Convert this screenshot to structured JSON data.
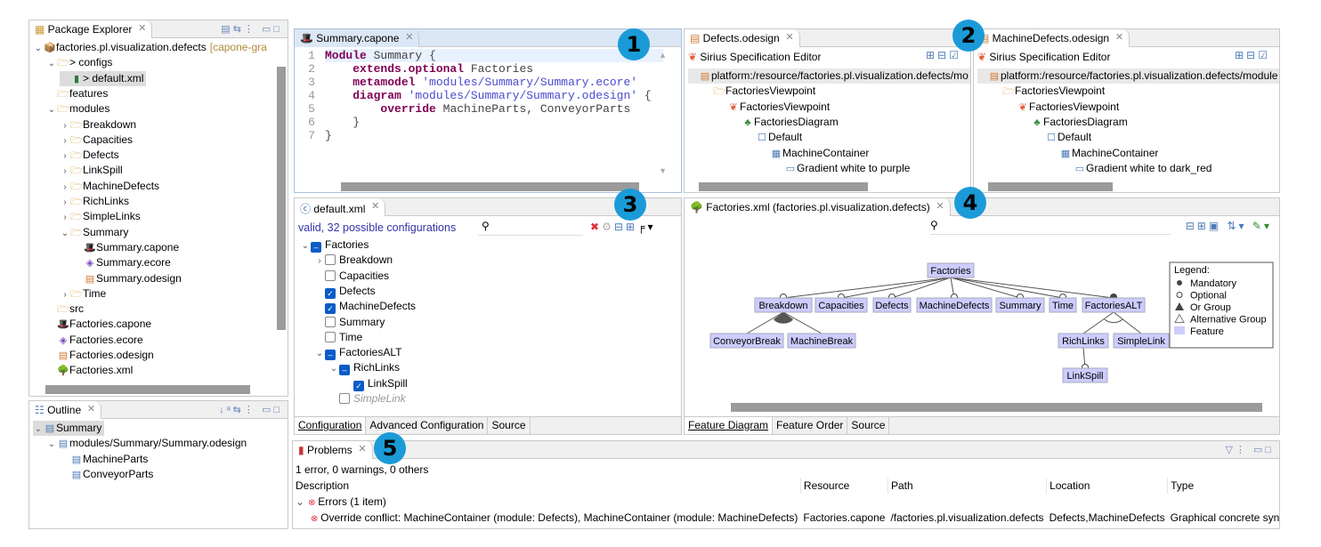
{
  "package_explorer": {
    "title": "Package Explorer",
    "items": [
      {
        "label": "factories.pl.visualization.defects",
        "suffix": "[capone-gra",
        "depth": 0,
        "tw": "v",
        "icon": "project-icon"
      },
      {
        "label": "> configs",
        "depth": 1,
        "tw": "v",
        "icon": "folder-icon"
      },
      {
        "label": "> default.xml",
        "depth": 2,
        "tw": "",
        "icon": "config-file-icon",
        "selected": true
      },
      {
        "label": "features",
        "depth": 1,
        "tw": "",
        "icon": "folder-icon"
      },
      {
        "label": "modules",
        "depth": 1,
        "tw": "v",
        "icon": "folder-icon"
      },
      {
        "label": "Breakdown",
        "depth": 2,
        "tw": ">",
        "icon": "folder-icon"
      },
      {
        "label": "Capacities",
        "depth": 2,
        "tw": ">",
        "icon": "folder-icon"
      },
      {
        "label": "Defects",
        "depth": 2,
        "tw": ">",
        "icon": "folder-icon"
      },
      {
        "label": "LinkSpill",
        "depth": 2,
        "tw": ">",
        "icon": "folder-icon"
      },
      {
        "label": "MachineDefects",
        "depth": 2,
        "tw": ">",
        "icon": "folder-icon"
      },
      {
        "label": "RichLinks",
        "depth": 2,
        "tw": ">",
        "icon": "folder-icon"
      },
      {
        "label": "SimpleLinks",
        "depth": 2,
        "tw": ">",
        "icon": "folder-icon"
      },
      {
        "label": "Summary",
        "depth": 2,
        "tw": "v",
        "icon": "folder-icon"
      },
      {
        "label": "Summary.capone",
        "depth": 3,
        "tw": "",
        "icon": "capone-file-icon"
      },
      {
        "label": "Summary.ecore",
        "depth": 3,
        "tw": "",
        "icon": "ecore-file-icon"
      },
      {
        "label": "Summary.odesign",
        "depth": 3,
        "tw": "",
        "icon": "odesign-file-icon"
      },
      {
        "label": "Time",
        "depth": 2,
        "tw": ">",
        "icon": "folder-icon"
      },
      {
        "label": "src",
        "depth": 1,
        "tw": "",
        "icon": "folder-icon"
      },
      {
        "label": "Factories.capone",
        "depth": 1,
        "tw": "",
        "icon": "capone-file-icon"
      },
      {
        "label": "Factories.ecore",
        "depth": 1,
        "tw": "",
        "icon": "ecore-file-icon"
      },
      {
        "label": "Factories.odesign",
        "depth": 1,
        "tw": "",
        "icon": "odesign-file-icon"
      },
      {
        "label": "Factories.xml",
        "depth": 1,
        "tw": "",
        "icon": "feature-model-icon"
      }
    ]
  },
  "outline": {
    "title": "Outline",
    "items": [
      {
        "label": "Summary",
        "depth": 0,
        "tw": "v",
        "selected": true
      },
      {
        "label": "modules/Summary/Summary.odesign",
        "depth": 1,
        "tw": "v"
      },
      {
        "label": "MachineParts",
        "depth": 2,
        "tw": ""
      },
      {
        "label": "ConveyorParts",
        "depth": 2,
        "tw": ""
      }
    ]
  },
  "editor": {
    "tab": "Summary.capone",
    "lines": [
      [
        [
          "kw",
          "Module"
        ],
        [
          "plain",
          " Summary {"
        ]
      ],
      [
        [
          "plain",
          "    "
        ],
        [
          "kw",
          "extends.optional"
        ],
        [
          "plain",
          " Factories"
        ]
      ],
      [
        [
          "plain",
          "    "
        ],
        [
          "kw",
          "metamodel"
        ],
        [
          "str",
          " 'modules/Summary/Summary.ecore'"
        ]
      ],
      [
        [
          "plain",
          "    "
        ],
        [
          "kw",
          "diagram"
        ],
        [
          "str",
          " 'modules/Summary/Summary.odesign'"
        ],
        [
          "plain",
          " {"
        ]
      ],
      [
        [
          "plain",
          "        "
        ],
        [
          "kw",
          "override"
        ],
        [
          "plain",
          " MachineParts, ConveyorParts"
        ]
      ],
      [
        [
          "plain",
          "    }"
        ]
      ],
      [
        [
          "plain",
          "}"
        ]
      ]
    ]
  },
  "odesign_left": {
    "tab": "Defects.odesign",
    "header": "Sirius Specification Editor",
    "items": [
      {
        "label": "platform:/resource/factories.pl.visualization.defects/mo",
        "depth": 0
      },
      {
        "label": "FactoriesViewpoint",
        "depth": 1
      },
      {
        "label": "FactoriesViewpoint",
        "depth": 2
      },
      {
        "label": "FactoriesDiagram",
        "depth": 3
      },
      {
        "label": "Default",
        "depth": 4
      },
      {
        "label": "MachineContainer",
        "depth": 5
      },
      {
        "label": "Gradient white to purple",
        "depth": 6
      }
    ]
  },
  "odesign_right": {
    "tab": "MachineDefects.odesign",
    "header": "Sirius Specification Editor",
    "items": [
      {
        "label": "platform:/resource/factories.pl.visualization.defects/module",
        "depth": 0
      },
      {
        "label": "FactoriesViewpoint",
        "depth": 1
      },
      {
        "label": "FactoriesViewpoint",
        "depth": 2
      },
      {
        "label": "FactoriesDiagram",
        "depth": 3
      },
      {
        "label": "Default",
        "depth": 4
      },
      {
        "label": "MachineContainer",
        "depth": 5
      },
      {
        "label": "Gradient white to dark_red",
        "depth": 6
      }
    ]
  },
  "config": {
    "tab": "default.xml",
    "status": "valid, 32 possible configurations",
    "search_placeholder": "",
    "items": [
      {
        "label": "Factories",
        "depth": 0,
        "tw": "v",
        "state": "partial"
      },
      {
        "label": "Breakdown",
        "depth": 1,
        "tw": ">",
        "state": "off"
      },
      {
        "label": "Capacities",
        "depth": 1,
        "tw": "",
        "state": "off"
      },
      {
        "label": "Defects",
        "depth": 1,
        "tw": "",
        "state": "on"
      },
      {
        "label": "MachineDefects",
        "depth": 1,
        "tw": "",
        "state": "on"
      },
      {
        "label": "Summary",
        "depth": 1,
        "tw": "",
        "state": "off"
      },
      {
        "label": "Time",
        "depth": 1,
        "tw": "",
        "state": "off"
      },
      {
        "label": "FactoriesALT",
        "depth": 1,
        "tw": "v",
        "state": "partial"
      },
      {
        "label": "RichLinks",
        "depth": 2,
        "tw": "v",
        "state": "partial"
      },
      {
        "label": "LinkSpill",
        "depth": 3,
        "tw": "",
        "state": "on"
      },
      {
        "label": "SimpleLink",
        "depth": 2,
        "tw": "",
        "state": "disabled"
      }
    ],
    "bottom_tabs": [
      "Configuration",
      "Advanced Configuration",
      "Source"
    ]
  },
  "feature_model": {
    "tab": "Factories.xml (factories.pl.visualization.defects)",
    "bottom_tabs": [
      "Feature Diagram",
      "Feature Order",
      "Source"
    ],
    "features": [
      {
        "name": "Factories",
        "parent": null
      },
      {
        "name": "Breakdown",
        "parent": "Factories",
        "kind": "optional"
      },
      {
        "name": "Capacities",
        "parent": "Factories",
        "kind": "optional"
      },
      {
        "name": "Defects",
        "parent": "Factories",
        "kind": "optional"
      },
      {
        "name": "MachineDefects",
        "parent": "Factories",
        "kind": "optional"
      },
      {
        "name": "Summary",
        "parent": "Factories",
        "kind": "optional"
      },
      {
        "name": "Time",
        "parent": "Factories",
        "kind": "optional"
      },
      {
        "name": "FactoriesALT",
        "parent": "Factories",
        "kind": "mandatory",
        "group": "alternative"
      },
      {
        "name": "ConveyorBreak",
        "parent": "Breakdown",
        "group": "or"
      },
      {
        "name": "MachineBreak",
        "parent": "Breakdown",
        "group": "or"
      },
      {
        "name": "RichLinks",
        "parent": "FactoriesALT"
      },
      {
        "name": "SimpleLink",
        "parent": "FactoriesALT"
      },
      {
        "name": "LinkSpill",
        "parent": "RichLinks",
        "kind": "optional"
      }
    ],
    "legend": {
      "title": "Legend:",
      "items": [
        "Mandatory",
        "Optional",
        "Or Group",
        "Alternative Group",
        "Feature"
      ]
    },
    "feature_color": "#ccccff"
  },
  "problems": {
    "tab": "Problems",
    "summary": "1 error, 0 warnings, 0 others",
    "columns": [
      "Description",
      "Resource",
      "Path",
      "Location",
      "Type"
    ],
    "group": "Errors (1 item)",
    "rows": [
      [
        "Override conflict: MachineContainer (module: Defects), MachineContainer (module: MachineDefects)",
        "Factories.capone",
        "/factories.pl.visualization.defects",
        "Defects,MachineDefects",
        "Graphical concrete syntax"
      ]
    ]
  },
  "badges": [
    "1",
    "2",
    "3",
    "4",
    "5"
  ],
  "colors": {
    "accent": "#1a9bd8",
    "checkbox": "#0a5cc7",
    "error": "#e0303a"
  }
}
